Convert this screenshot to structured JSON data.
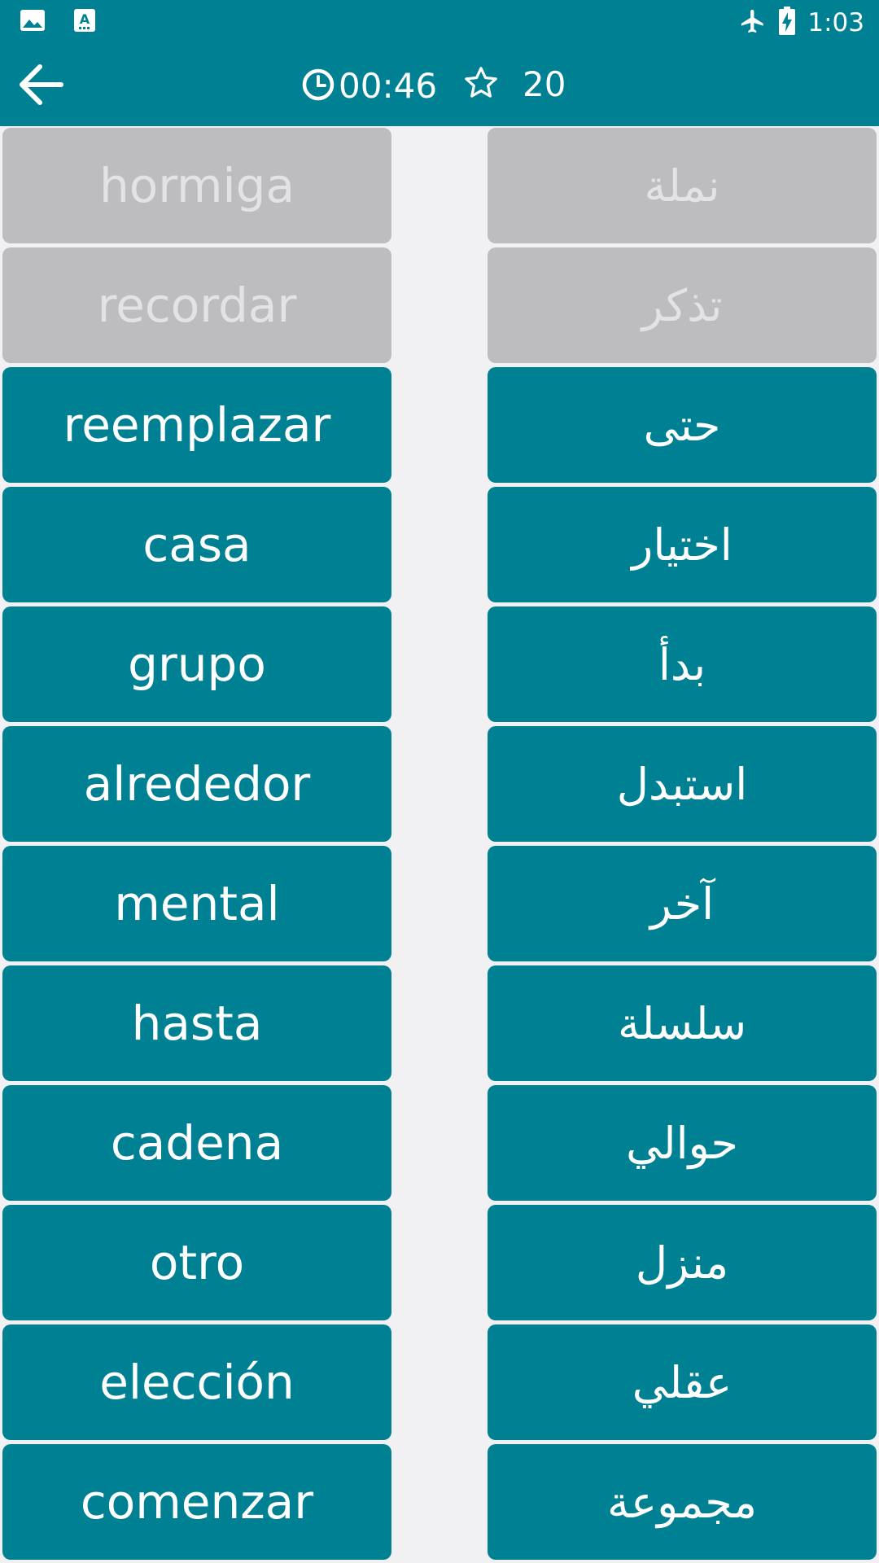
{
  "status_bar": {
    "time": "1:03",
    "icons": [
      "image-icon",
      "font-download-icon",
      "airplane-icon",
      "battery-charging-icon"
    ]
  },
  "header": {
    "back_icon": "arrow-left-icon",
    "timer": "00:46",
    "timer_icon": "clock-icon",
    "score_icon": "star-outline-icon",
    "score": "20"
  },
  "colors": {
    "primary": "#008193",
    "matched_bg": "#bdbdc0",
    "matched_text": "#e3e3e6",
    "background": "#f1f1f3"
  },
  "left_words": [
    {
      "text": "hormiga",
      "matched": true
    },
    {
      "text": "recordar",
      "matched": true
    },
    {
      "text": "reemplazar",
      "matched": false
    },
    {
      "text": "casa",
      "matched": false
    },
    {
      "text": "grupo",
      "matched": false
    },
    {
      "text": "alrededor",
      "matched": false
    },
    {
      "text": "mental",
      "matched": false
    },
    {
      "text": "hasta",
      "matched": false
    },
    {
      "text": "cadena",
      "matched": false
    },
    {
      "text": "otro",
      "matched": false
    },
    {
      "text": "elección",
      "matched": false
    },
    {
      "text": "comenzar",
      "matched": false
    }
  ],
  "right_words": [
    {
      "text": "نملة",
      "matched": true
    },
    {
      "text": "تذكر",
      "matched": true
    },
    {
      "text": "حتى",
      "matched": false
    },
    {
      "text": "اختيار",
      "matched": false
    },
    {
      "text": "بدأ",
      "matched": false
    },
    {
      "text": "استبدل",
      "matched": false
    },
    {
      "text": "آخر",
      "matched": false
    },
    {
      "text": "سلسلة",
      "matched": false
    },
    {
      "text": "حوالي",
      "matched": false
    },
    {
      "text": "منزل",
      "matched": false
    },
    {
      "text": "عقلي",
      "matched": false
    },
    {
      "text": "مجموعة",
      "matched": false
    }
  ]
}
